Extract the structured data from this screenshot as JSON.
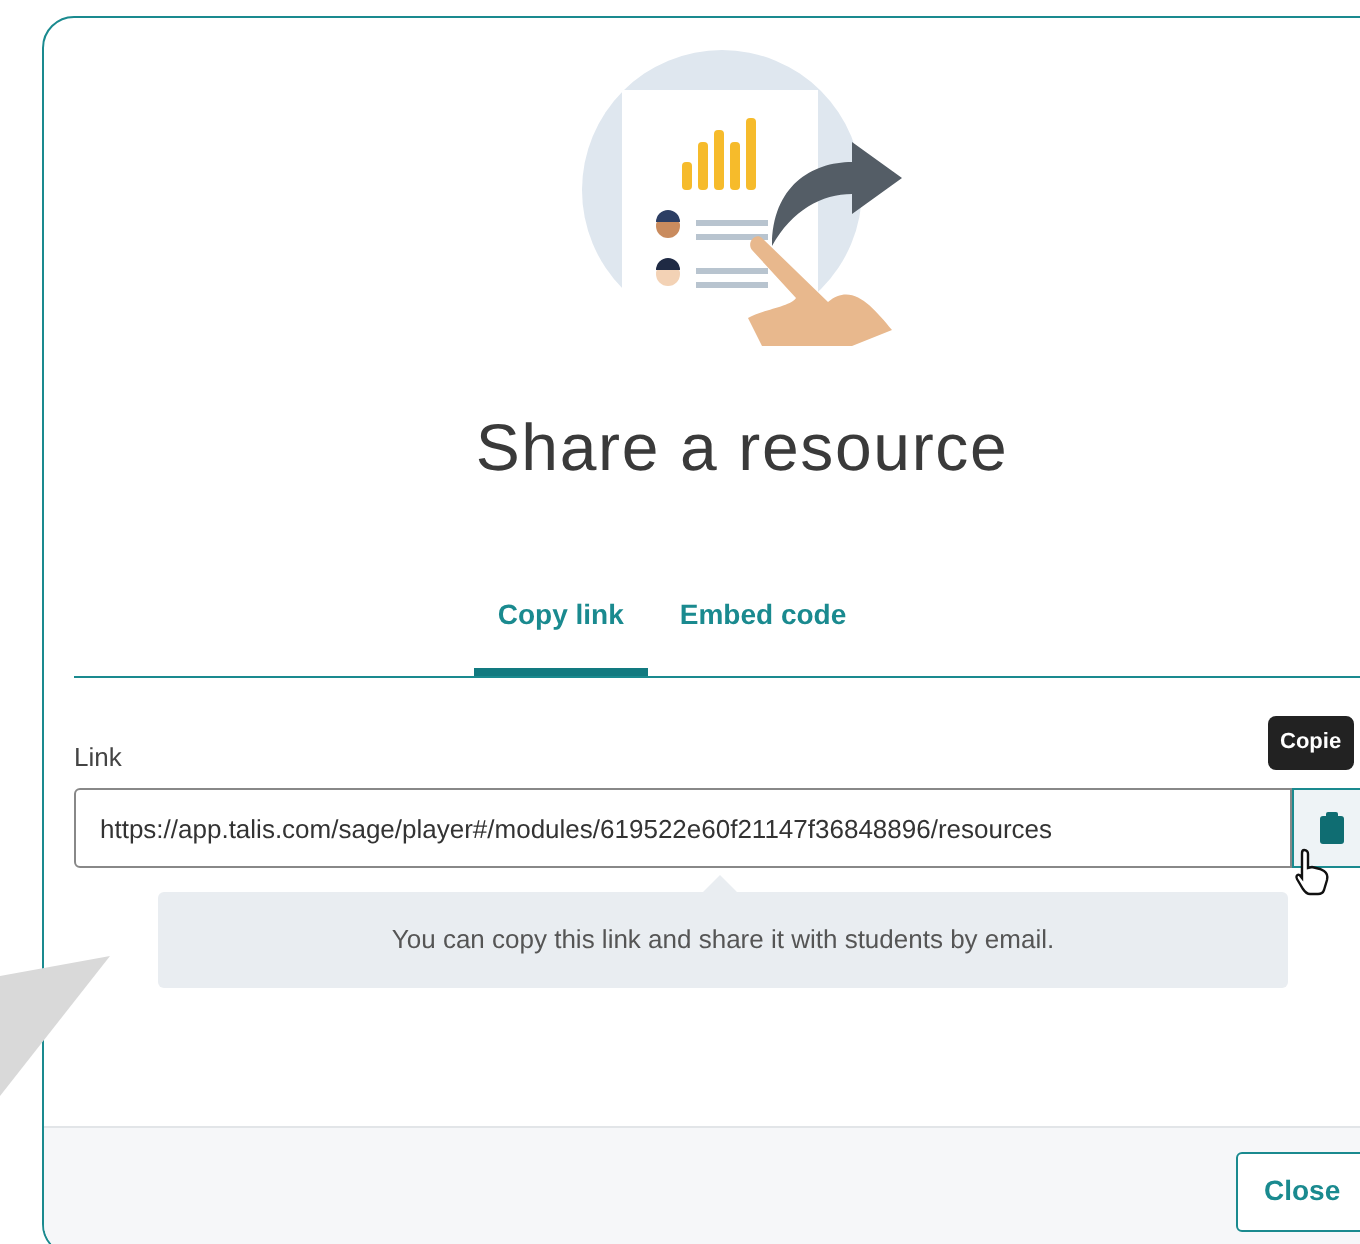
{
  "dialog": {
    "title": "Share a resource"
  },
  "tabs": [
    {
      "label": "Copy link",
      "selected": true
    },
    {
      "label": "Embed code",
      "selected": false
    }
  ],
  "link_field": {
    "label": "Link",
    "value": "https://app.talis.com/sage/player#/modules/619522e60f21147f36848896/resources"
  },
  "copy_tooltip": "Copie",
  "hint": "You can copy this link and share it with students by email.",
  "footer": {
    "buttons": [
      "Close"
    ]
  }
}
